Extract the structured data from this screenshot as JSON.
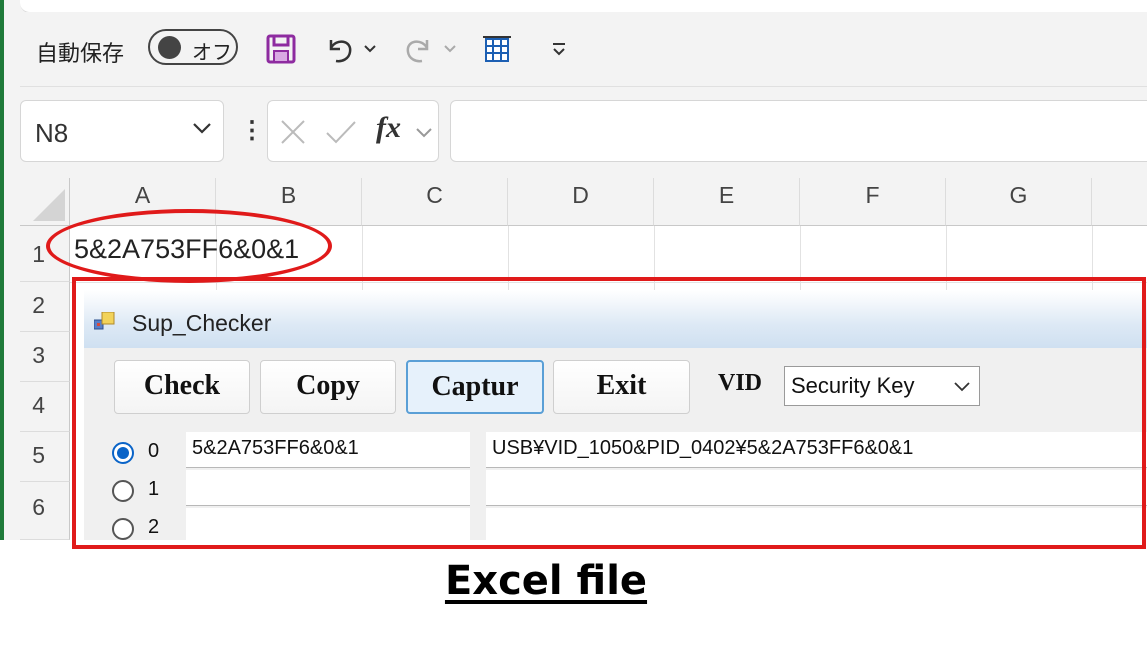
{
  "excel": {
    "quick_access": {
      "autosave_label": "自動保存",
      "autosave_toggle": "オフ",
      "icons": [
        "save-icon",
        "undo-icon",
        "redo-icon",
        "print-layout-icon",
        "customize-toolbar-icon"
      ]
    },
    "name_box": {
      "value": "N8"
    },
    "formula_bar": {
      "dots": "⋮",
      "fx_label": "fx",
      "value": ""
    },
    "columns": [
      "A",
      "B",
      "C",
      "D",
      "E",
      "F",
      "G"
    ],
    "rows": [
      "1",
      "2",
      "3",
      "4",
      "5",
      "6"
    ],
    "cells": {
      "A1": "5&2A753FF6&0&1"
    },
    "annotation_color": "#e01a1a"
  },
  "dialog": {
    "title": "Sup_Checker",
    "buttons": [
      "Check",
      "Copy",
      "Captur",
      "Exit"
    ],
    "active_button": "Captur",
    "vid_label": "VID",
    "vid_selected": "Security Key",
    "selected_index": "0",
    "devices": [
      {
        "index": "0",
        "instance": "5&2A753FF6&0&1",
        "path": "USB¥VID_1050&PID_0402¥5&2A753FF6&0&1"
      },
      {
        "index": "1",
        "instance": "",
        "path": ""
      },
      {
        "index": "2",
        "instance": "",
        "path": ""
      }
    ]
  },
  "caption": "Excel file"
}
